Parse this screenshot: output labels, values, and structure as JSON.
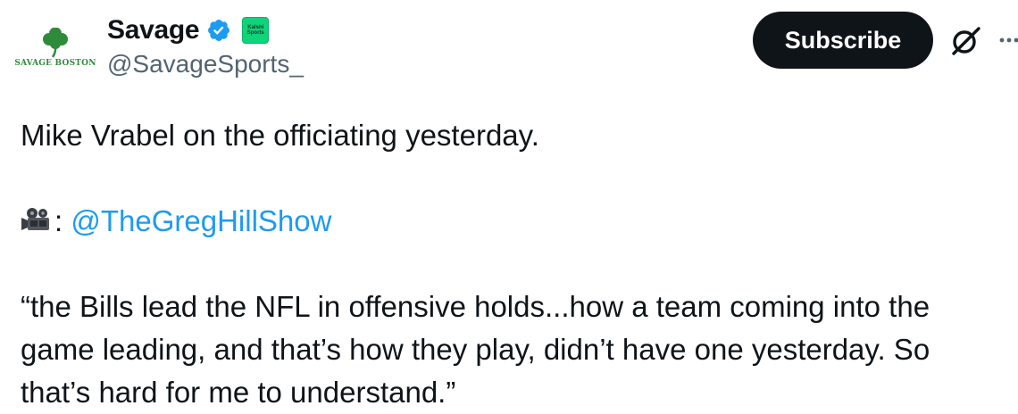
{
  "header": {
    "avatar": {
      "icon": "shamrock-icon",
      "text": "SAVAGE BOSTON",
      "brand_color": "#2e8b3a"
    },
    "display_name": "Savage",
    "verified_icon": "verified-badge-icon",
    "verified_color": "#1d9bf0",
    "affiliate_badge": {
      "line1": "Kalshi",
      "line2": "Sports",
      "color": "#0fd47a"
    },
    "handle": "@SavageSports_"
  },
  "actions": {
    "subscribe_label": "Subscribe",
    "grok_icon": "grok-icon",
    "more_icon": "more-icon"
  },
  "tweet": {
    "line1": "Mike Vrabel on the officiating yesterday.",
    "camera_icon": "movie-camera-icon",
    "credit_separator": ":",
    "credit_mention": "@TheGregHillShow",
    "mention_color": "#1d9bf0",
    "quote_lines": [
      "“the Bills lead the NFL in offensive holds...how a team coming into the",
      "game leading, and that’s how they play, didn’t have one yesterday. So",
      "that’s hard for me to understand.”"
    ]
  }
}
